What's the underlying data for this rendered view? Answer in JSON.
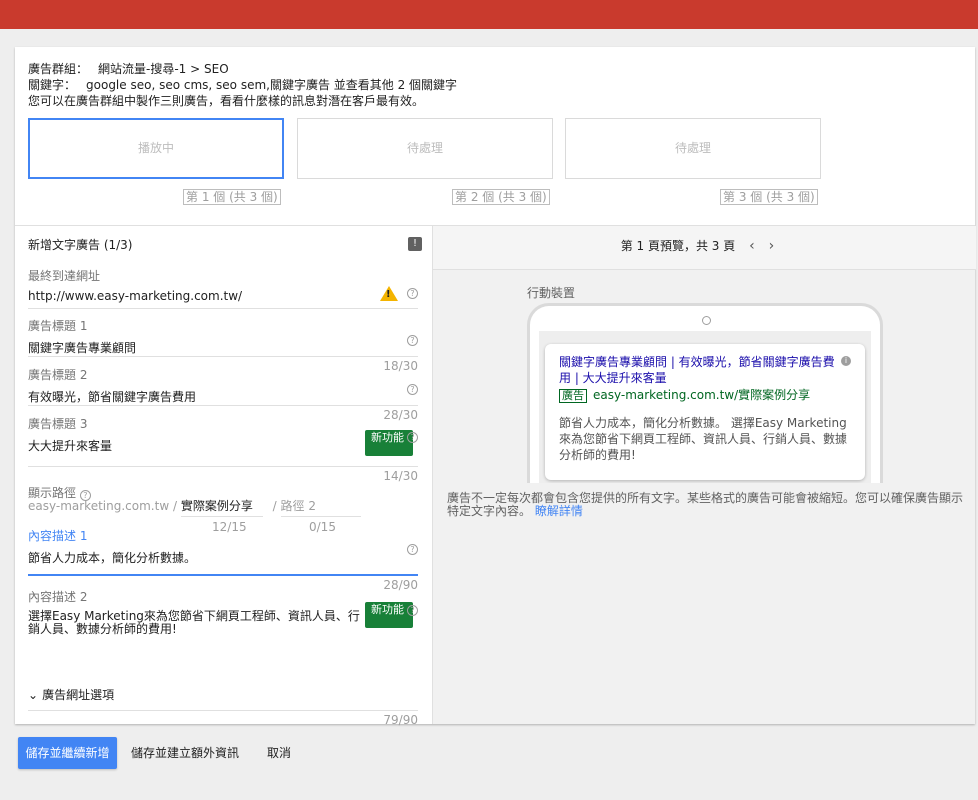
{
  "colors": {
    "topbar": "#c93a2d",
    "accent": "#4285f4",
    "new_badge": "#188038",
    "ad_headline": "#1a0dab",
    "ad_url": "#006621"
  },
  "group": {
    "group_label": "廣告群組：",
    "group_value": "網站流量-搜尋-1 > SEO",
    "keyword_label": "關鍵字：",
    "keyword_value": "google seo, seo cms, seo sem,關鍵字廣告 並查看其他 2 個關鍵字",
    "hint": "您可以在廣告群組中製作三則廣告，看看什麼樣的訊息對潛在客戶最有效。"
  },
  "slots": [
    {
      "status": "播放中",
      "caption": "第 1 個 (共 3 個)"
    },
    {
      "status": "待處理",
      "caption": "第 2 個 (共 3 個)"
    },
    {
      "status": "待處理",
      "caption": "第 3 個 (共 3 個)"
    }
  ],
  "form": {
    "title": "新增文字廣告 (1/3)",
    "icon": "feedback-icon",
    "final_url": {
      "label": "最終到達網址",
      "value": "http://www.easy-marketing.com.tw/",
      "warn_icon": "warning-icon"
    },
    "headline1": {
      "label": "廣告標題 1",
      "value": "關鍵字廣告專業顧問",
      "count": "18/30"
    },
    "headline2": {
      "label": "廣告標題 2",
      "value": "有效曝光，節省關鍵字廣告費用",
      "count": "28/30"
    },
    "headline3": {
      "label": "廣告標題 3",
      "value": "大大提升來客量",
      "count": "14/30",
      "badge": "新功能"
    },
    "display_path": {
      "label": "顯示路徑",
      "domain": "easy-marketing.com.tw /",
      "path1": "實際案例分享",
      "sep": "/",
      "path2_placeholder": "路徑 2",
      "count1": "12/15",
      "count2": "0/15"
    },
    "desc1": {
      "label": "內容描述 1",
      "value": "節省人力成本，簡化分析數據。",
      "count": "28/90"
    },
    "desc2": {
      "label": "內容描述 2",
      "value_line1": "選擇Easy Marketing來為您節省下網頁工程師、資訊人員、行",
      "value_line2": "銷人員、數據分析師的費用!",
      "count": "79/90",
      "badge": "新功能"
    },
    "url_options": "廣告網址選項"
  },
  "preview": {
    "header": "第 1 頁預覽，共 3 頁",
    "prev_icon": "chevron-left-icon",
    "next_icon": "chevron-right-icon",
    "device_label": "行動裝置",
    "ad": {
      "headline": "關鍵字廣告專業顧問 | 有效曝光，節省關鍵字廣告費用 | 大大提升來客量",
      "tag": "廣告",
      "url": "easy-marketing.com.tw/實際案例分享",
      "description": "節省人力成本，簡化分析數據。 選擇Easy Marketing來為您節省下網頁工程師、資訊人員、行銷人員、數據分析師的費用!"
    },
    "disclaimer": "廣告不一定每次都會包含您提供的所有文字。某些格式的廣告可能會被縮短。您可以確保廣告顯示特定文字內容。",
    "learn_more": "瞭解詳情"
  },
  "actions": {
    "save_continue": "儲存並繼續新增",
    "save_extensions": "儲存並建立額外資訊",
    "cancel": "取消"
  }
}
